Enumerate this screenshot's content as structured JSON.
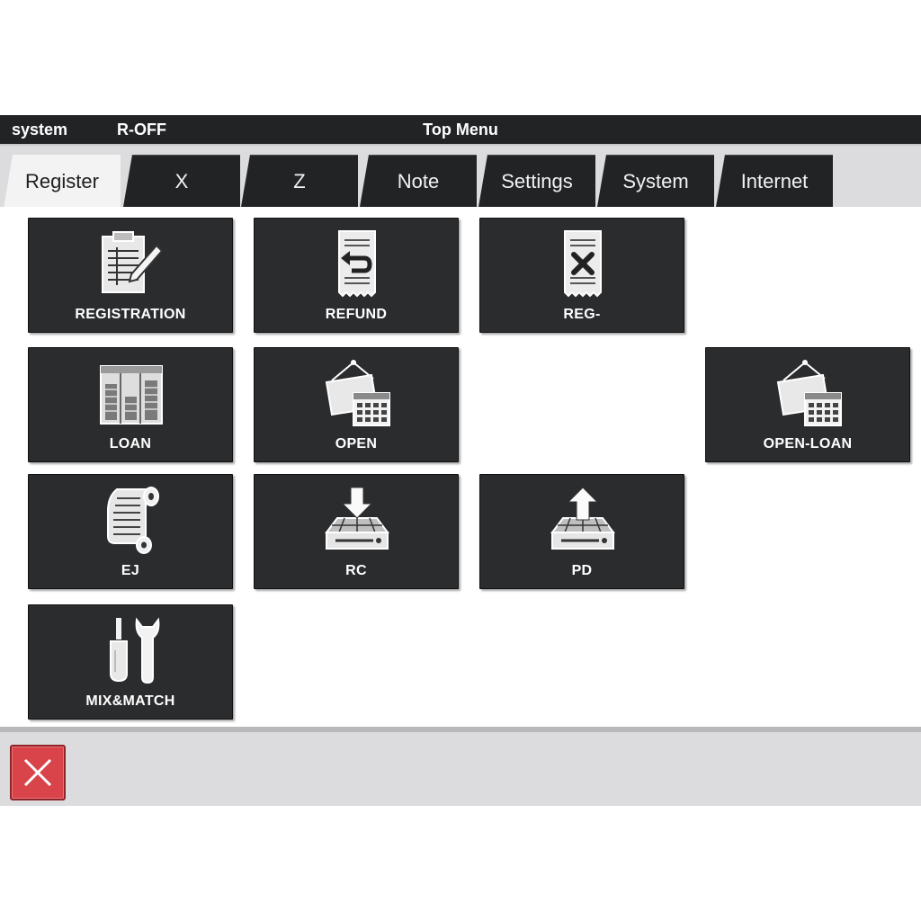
{
  "status_bar": {
    "user": "system",
    "mode": "R-OFF",
    "title": "Top Menu"
  },
  "tabs": [
    {
      "label": "Register",
      "active": true
    },
    {
      "label": "X",
      "active": false
    },
    {
      "label": "Z",
      "active": false
    },
    {
      "label": "Note",
      "active": false
    },
    {
      "label": "Settings",
      "active": false
    },
    {
      "label": "System",
      "active": false
    },
    {
      "label": "Internet",
      "active": false
    }
  ],
  "menu": {
    "registration": {
      "label": "REGISTRATION",
      "icon": "clipboard-pen-icon"
    },
    "refund": {
      "label": "REFUND",
      "icon": "receipt-return-icon"
    },
    "reg_minus": {
      "label": "REG-",
      "icon": "receipt-cancel-icon"
    },
    "loan": {
      "label": "LOAN",
      "icon": "cash-drawer-coins-icon"
    },
    "open": {
      "label": "OPEN",
      "icon": "open-sign-calendar-icon"
    },
    "open_loan": {
      "label": "OPEN-LOAN",
      "icon": "open-sign-calendar-icon"
    },
    "ej": {
      "label": "EJ",
      "icon": "journal-roll-icon"
    },
    "rc": {
      "label": "RC",
      "icon": "drawer-in-icon"
    },
    "pd": {
      "label": "PD",
      "icon": "drawer-out-icon"
    },
    "mix_match": {
      "label": "MIX&MATCH",
      "icon": "tools-icon"
    }
  },
  "bottom_bar": {
    "close_icon": "close-icon"
  },
  "colors": {
    "tile": "#2b2c2e",
    "status_bar": "#222325",
    "close": "#d9434a"
  }
}
